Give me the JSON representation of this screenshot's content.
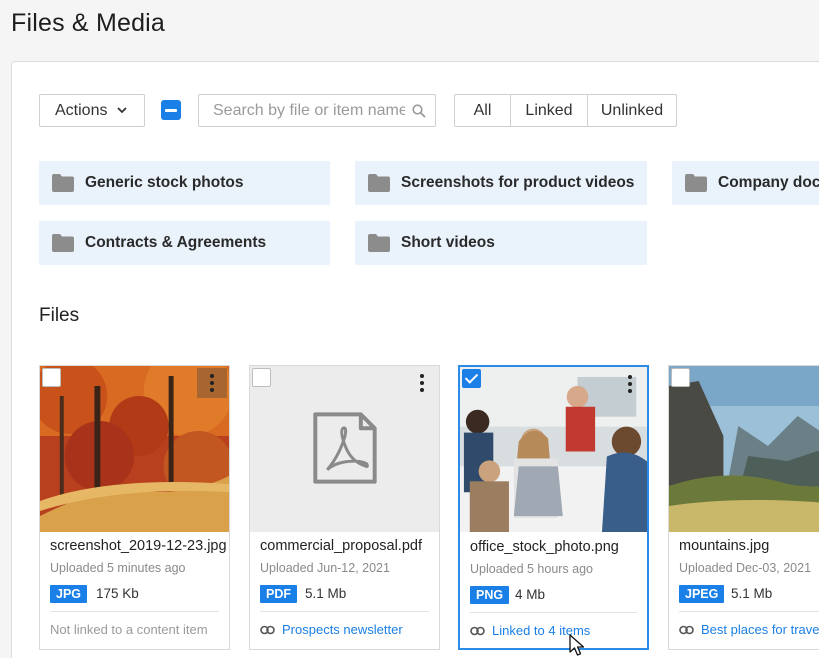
{
  "page": {
    "title": "Files & Media"
  },
  "toolbar": {
    "actions_label": "Actions",
    "search_placeholder": "Search by file or item name",
    "search_value": "",
    "filters": [
      "All",
      "Linked",
      "Unlinked"
    ]
  },
  "folders": [
    {
      "label": "Generic stock photos"
    },
    {
      "label": "Screenshots for product videos"
    },
    {
      "label": "Company documents"
    },
    {
      "label": "Contracts & Agreements"
    },
    {
      "label": "Short videos"
    }
  ],
  "files_section": {
    "title": "Files"
  },
  "files": [
    {
      "name": "screenshot_2019-12-23.jpg",
      "uploaded": "Uploaded 5 minutes ago",
      "type": "JPG",
      "size": "175 Kb",
      "link": "Not linked to a content item",
      "linked": false,
      "selected": false,
      "thumbnail": "autumn-forest"
    },
    {
      "name": "commercial_proposal.pdf",
      "uploaded": "Uploaded Jun-12, 2021",
      "type": "PDF",
      "size": "5.1 Mb",
      "link": "Prospects newsletter",
      "linked": true,
      "selected": false,
      "thumbnail": "pdf-icon"
    },
    {
      "name": "office_stock_photo.png",
      "uploaded": "Uploaded 5 hours ago",
      "type": "PNG",
      "size": "4 Mb",
      "link": "Linked to 4 items",
      "linked": true,
      "selected": true,
      "thumbnail": "office-meeting"
    },
    {
      "name": "mountains.jpg",
      "uploaded": "Uploaded Dec-03, 2021",
      "type": "JPEG",
      "size": "5.1 Mb",
      "link": "Best places for travel",
      "linked": true,
      "selected": false,
      "thumbnail": "mountain-valley"
    }
  ],
  "colors": {
    "accent": "#1a7fe6",
    "folder_bg": "#eaf3fc",
    "muted": "#9a9a9a"
  }
}
